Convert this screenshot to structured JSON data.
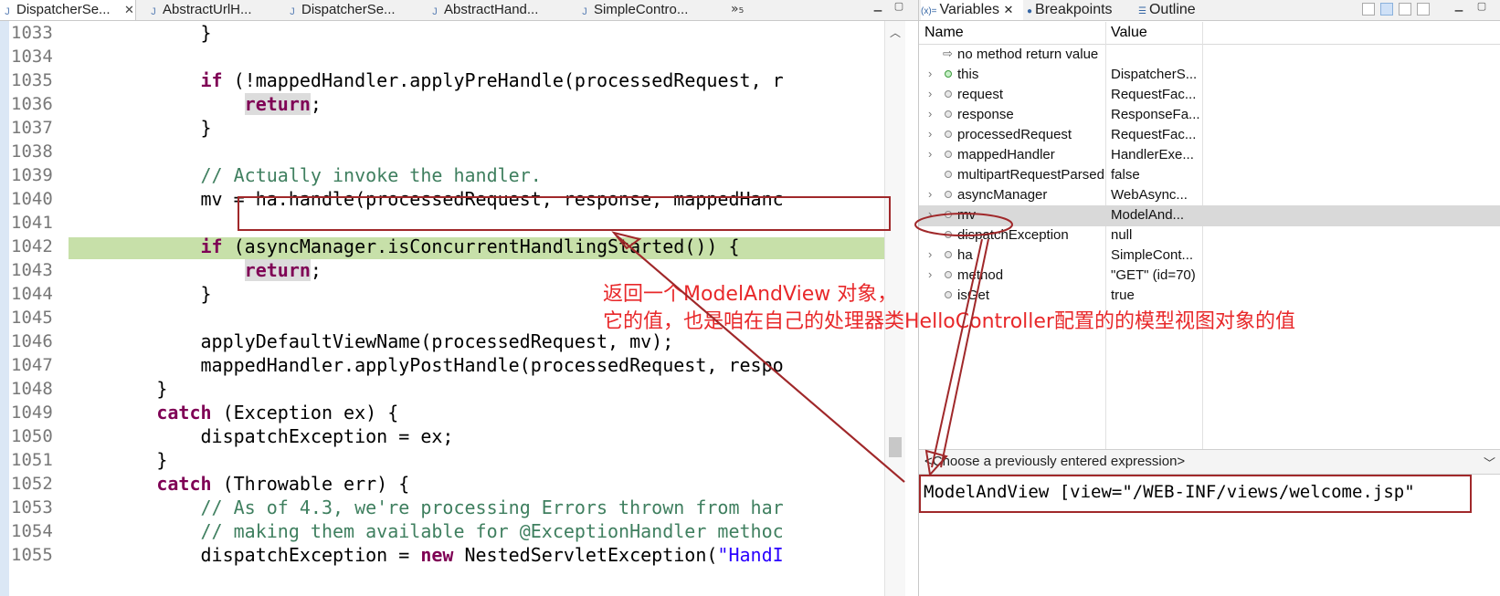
{
  "editor": {
    "tabs": [
      {
        "label": "DispatcherSe...",
        "active": true
      },
      {
        "label": "AbstractUrlH...",
        "active": false
      },
      {
        "label": "DispatcherSe...",
        "active": false
      },
      {
        "label": "AbstractHand...",
        "active": false
      },
      {
        "label": "SimpleContro...",
        "active": false
      }
    ],
    "overflow_label": "»₅",
    "lines": [
      {
        "no": "1033",
        "code": "            }"
      },
      {
        "no": "1034",
        "code": ""
      },
      {
        "no": "1035",
        "code": "            if (!mappedHandler.applyPreHandle(processedRequest, r"
      },
      {
        "no": "1036",
        "code": "                return;"
      },
      {
        "no": "1037",
        "code": "            }"
      },
      {
        "no": "1038",
        "code": ""
      },
      {
        "no": "1039",
        "code": "            // Actually invoke the handler."
      },
      {
        "no": "1040",
        "code": "            mv = ha.handle(processedRequest, response, mappedHanc"
      },
      {
        "no": "1041",
        "code": ""
      },
      {
        "no": "1042",
        "code": "            if (asyncManager.isConcurrentHandlingStarted()) {"
      },
      {
        "no": "1043",
        "code": "                return;"
      },
      {
        "no": "1044",
        "code": "            }"
      },
      {
        "no": "1045",
        "code": ""
      },
      {
        "no": "1046",
        "code": "            applyDefaultViewName(processedRequest, mv);"
      },
      {
        "no": "1047",
        "code": "            mappedHandler.applyPostHandle(processedRequest, respo"
      },
      {
        "no": "1048",
        "code": "        }"
      },
      {
        "no": "1049",
        "code": "        catch (Exception ex) {"
      },
      {
        "no": "1050",
        "code": "            dispatchException = ex;"
      },
      {
        "no": "1051",
        "code": "        }"
      },
      {
        "no": "1052",
        "code": "        catch (Throwable err) {"
      },
      {
        "no": "1053",
        "code": "            // As of 4.3, we're processing Errors thrown from har"
      },
      {
        "no": "1054",
        "code": "            // making them available for @ExceptionHandler methoc"
      },
      {
        "no": "1055",
        "code": "            dispatchException = new NestedServletException(\"HandI"
      }
    ]
  },
  "variables_view": {
    "tabs": [
      {
        "label": "Variables",
        "icon": "(x)="
      },
      {
        "label": "Breakpoints",
        "icon": "breakpoint-icon"
      },
      {
        "label": "Outline",
        "icon": "outline-icon"
      }
    ],
    "columns": {
      "name": "Name",
      "value": "Value"
    },
    "rows": [
      {
        "name": "no method return value",
        "value": "",
        "expandable": false,
        "kind": "return"
      },
      {
        "name": "this",
        "value": "DispatcherS...",
        "expandable": true,
        "kind": "field"
      },
      {
        "name": "request",
        "value": "RequestFac...",
        "expandable": true,
        "kind": "local"
      },
      {
        "name": "response",
        "value": "ResponseFa...",
        "expandable": true,
        "kind": "local"
      },
      {
        "name": "processedRequest",
        "value": "RequestFac...",
        "expandable": true,
        "kind": "local"
      },
      {
        "name": "mappedHandler",
        "value": "HandlerExe...",
        "expandable": true,
        "kind": "local"
      },
      {
        "name": "multipartRequestParsed",
        "value": "false",
        "expandable": false,
        "kind": "local"
      },
      {
        "name": "asyncManager",
        "value": "WebAsync...",
        "expandable": true,
        "kind": "local"
      },
      {
        "name": "mv",
        "value": "ModelAnd...",
        "expandable": true,
        "kind": "local",
        "selected": true
      },
      {
        "name": "dispatchException",
        "value": "null",
        "expandable": false,
        "kind": "local"
      },
      {
        "name": "ha",
        "value": "SimpleCont...",
        "expandable": true,
        "kind": "local"
      },
      {
        "name": "method",
        "value": "\"GET\" (id=70)",
        "expandable": true,
        "kind": "local"
      },
      {
        "name": "isGet",
        "value": "true",
        "expandable": false,
        "kind": "local"
      }
    ],
    "expression_placeholder": "<Choose a previously entered expression>",
    "detail_value": "ModelAndView [view=\"/WEB-INF/views/welcome.jsp\""
  },
  "annotation": {
    "line1": "返回一个ModelAndView 对象，",
    "line2": "它的值，也是咱在自己的处理器类HelloController配置的的模型视图对象的值",
    "color": "#e8282a"
  },
  "colors": {
    "highlight_line": "#c7e0a9",
    "keyword": "#7f0055",
    "comment": "#3f7f5f",
    "annotation_box": "#a0282a"
  }
}
